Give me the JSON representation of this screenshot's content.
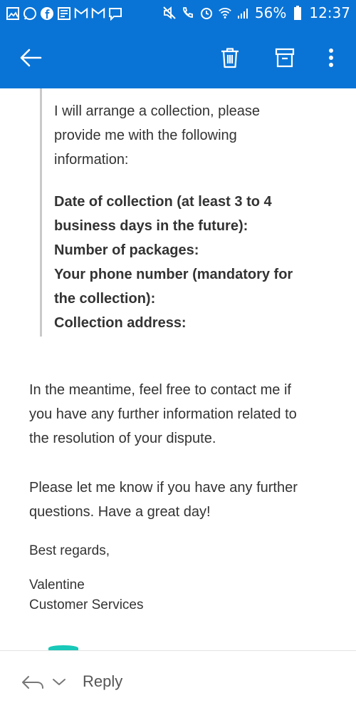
{
  "status_bar": {
    "battery": "56%",
    "time": "12:37"
  },
  "icons": {
    "back": "back-arrow-icon",
    "delete": "trash-icon",
    "archive": "archive-icon",
    "more": "more-vertical-icon",
    "reply": "reply-arrow-icon",
    "reply_options": "chevron-down-icon"
  },
  "colors": {
    "header_background": "#0a74d6",
    "text": "#333333",
    "quote_border": "#c9c9c9"
  },
  "message": {
    "quoted": {
      "intro_lines": [
        "I will arrange a collection, please",
        "provide me with the following",
        "information:"
      ],
      "required_lines": [
        "Date of collection (at least 3 to 4",
        "business days in the future):",
        "Number of packages:",
        "Your phone number (mandatory for",
        "the collection):",
        "Collection address:"
      ]
    },
    "paragraph1_lines": [
      "In the meantime, feel free to contact me if",
      "you have any further information related to",
      "the resolution of your dispute."
    ],
    "paragraph2_lines": [
      "Please let me know if you have any further",
      "questions. Have a great day!"
    ],
    "closing": "Best regards,",
    "signature_name": "Valentine",
    "signature_title": "Customer Services"
  },
  "footer": {
    "reply_label": "Reply"
  }
}
